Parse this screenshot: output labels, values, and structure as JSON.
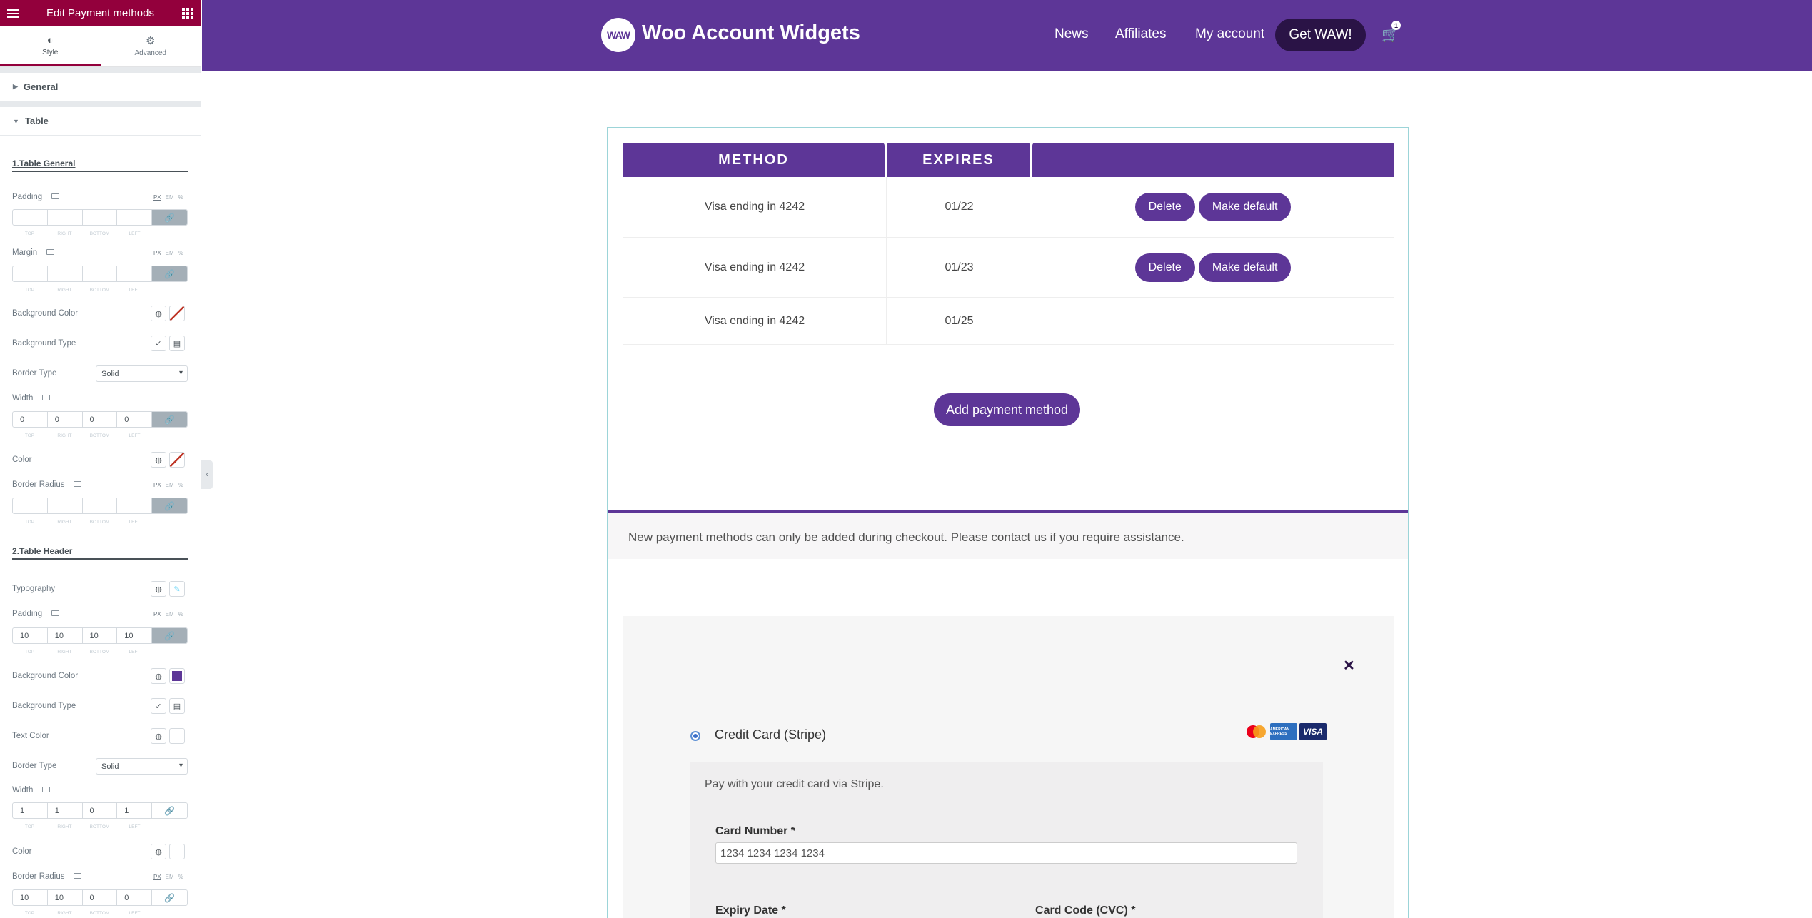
{
  "panel": {
    "title": "Edit Payment methods",
    "tabs": [
      {
        "label": "Style",
        "icon": "half-circle-icon"
      },
      {
        "label": "Advanced",
        "icon": "gear-icon"
      }
    ],
    "sections": {
      "general": "General",
      "table": "Table"
    },
    "table_general": {
      "heading": "1.Table General",
      "padding_label": "Padding",
      "margin_label": "Margin",
      "bg_color_label": "Background Color",
      "bg_type_label": "Background Type",
      "border_type_label": "Border Type",
      "border_type_value": "Solid",
      "width_label": "Width",
      "width_values": [
        "0",
        "0",
        "0",
        "0"
      ],
      "color_label": "Color",
      "radius_label": "Border Radius"
    },
    "table_header": {
      "heading": "2.Table Header",
      "typography_label": "Typography",
      "padding_label": "Padding",
      "padding_values": [
        "10",
        "10",
        "10",
        "10"
      ],
      "bg_color_label": "Background Color",
      "bg_color": "#5d3697",
      "bg_type_label": "Background Type",
      "text_color_label": "Text Color",
      "border_type_label": "Border Type",
      "border_type_value": "Solid",
      "width_label": "Width",
      "width_values": [
        "1",
        "1",
        "0",
        "1"
      ],
      "color_label": "Color",
      "radius_label": "Border Radius",
      "radius_values": [
        "10",
        "10",
        "0",
        "0"
      ]
    },
    "units": [
      "PX",
      "EM",
      "%"
    ],
    "dim_labels": [
      "TOP",
      "RIGHT",
      "BOTTOM",
      "LEFT"
    ],
    "accent": "#93003c"
  },
  "site": {
    "logo_text": "WAW",
    "brand": "Woo Account Widgets",
    "menu": [
      "News",
      "Affiliates",
      "My account"
    ],
    "cta": "Get WAW!",
    "cart_count": "1",
    "primary": "#5d3697"
  },
  "table": {
    "headers": [
      "METHOD",
      "EXPIRES",
      ""
    ],
    "rows": [
      {
        "method": "Visa ending in 4242",
        "expires": "01/22",
        "actions": [
          "Delete",
          "Make default"
        ]
      },
      {
        "method": "Visa ending in 4242",
        "expires": "01/23",
        "actions": [
          "Delete",
          "Make default"
        ]
      },
      {
        "method": "Visa ending in 4242",
        "expires": "01/25",
        "actions": []
      }
    ]
  },
  "add_button": "Add payment method",
  "notice": "New payment methods can only be added during checkout. Please contact us if you require assistance.",
  "form": {
    "close": "✕",
    "gateway": "Credit Card (Stripe)",
    "description": "Pay with your credit card via Stripe.",
    "card_number_label": "Card Number *",
    "card_number_placeholder": "1234 1234 1234 1234",
    "expiry_label": "Expiry Date *",
    "cvc_label": "Card Code (CVC) *"
  }
}
